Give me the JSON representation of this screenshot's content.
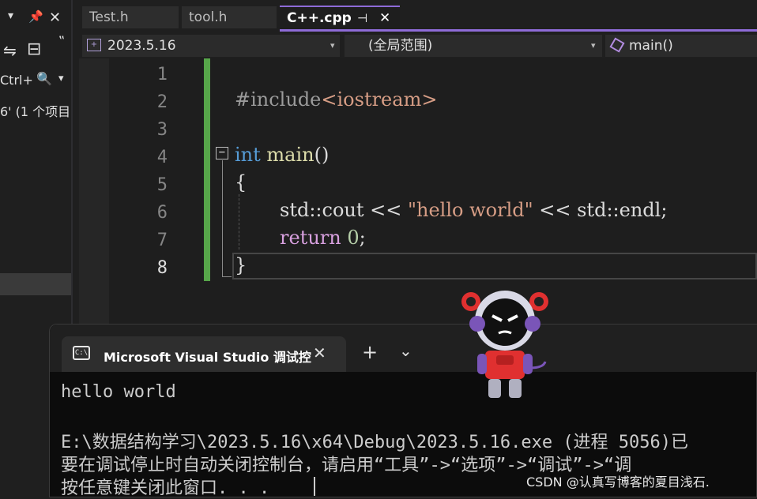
{
  "left_panel": {
    "dropdown_glyph": "▾",
    "pin_glyph": "📌",
    "close_glyph": "✕",
    "more_glyph": "‟",
    "sync_glyph": "⇋",
    "collapse_glyph": "⊟",
    "search_text": "Ctrl+",
    "search_icon": "🔍",
    "search_dd": "▾",
    "results_text": "6' (1 个项目"
  },
  "tabs": [
    {
      "label": "Test.h"
    },
    {
      "label": "tool.h"
    },
    {
      "label": "C++.cpp",
      "pin": "⊣",
      "close": "✕"
    }
  ],
  "navbar": {
    "project": "2023.5.16",
    "scope": "(全局范围)",
    "member": "main()",
    "chevron": "▾"
  },
  "editor": {
    "line_numbers": [
      "1",
      "2",
      "3",
      "4",
      "5",
      "6",
      "7",
      "8"
    ],
    "collapse_glyph": "−",
    "line2_pp": "#include",
    "line2_inc": "<iostream>",
    "line4_kw": "int",
    "line4_fn": "main",
    "line4_rest": "()",
    "line5": "{",
    "line6_a": "std::cout << ",
    "line6_str": "\"hello world\"",
    "line6_b": " << std::endl;",
    "line7_ctl": "return",
    "line7_num": "0",
    "line7_semi": ";",
    "line8": "}"
  },
  "terminal": {
    "title": "Microsoft Visual Studio 调试控",
    "close": "✕",
    "new_tab": "+",
    "dropdown": "⌄",
    "icon_text": "C:\\",
    "lines": [
      "hello world",
      "",
      "E:\\数据结构学习\\2023.5.16\\x64\\Debug\\2023.5.16.exe (进程 5056)已",
      "要在调试停止时自动关闭控制台，请启用“工具”->“选项”->“调试”->“调",
      "按任意键关闭此窗口. . ."
    ]
  },
  "watermark": "CSDN @认真写博客的夏目浅石."
}
